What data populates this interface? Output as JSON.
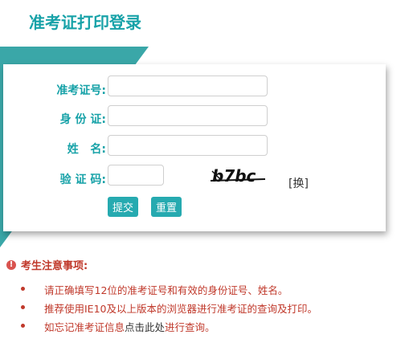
{
  "page": {
    "title": "准考证打印登录"
  },
  "form": {
    "admission_label": "准考证号:",
    "admission_value": "",
    "id_label": "身 份 证:",
    "id_value": "",
    "name_label": "姓   名:",
    "name_value": "",
    "captcha_label": "验 证 码:",
    "captcha_value": "",
    "captcha_text": "b7bc",
    "captcha_refresh": "[换]",
    "submit_label": "提交",
    "reset_label": "重置"
  },
  "notice": {
    "title": "考生注意事项:",
    "items": [
      {
        "text": "请正确填写12位的准考证号和有效的身份证号、姓名。"
      },
      {
        "text": "推荐使用IE10及以上版本的浏览器进行准考证的查询及打印。"
      },
      {
        "prefix": "如忘记准考证信息",
        "link": "点击此处",
        "suffix": "进行查询。"
      }
    ]
  },
  "colors": {
    "accent": "#17a2a8",
    "button": "#26aab0",
    "warning": "#c0392b"
  }
}
